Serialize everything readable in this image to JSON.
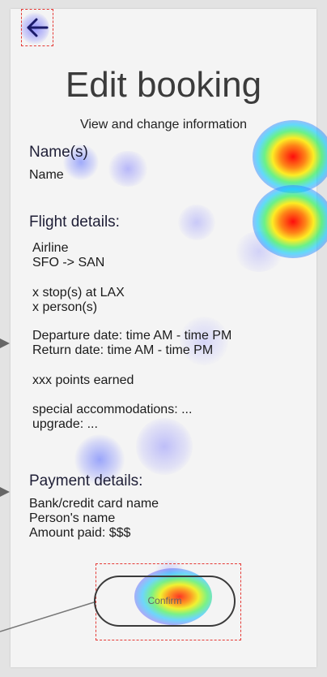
{
  "header": {
    "back_icon": "arrow-left-icon",
    "title": "Edit booking",
    "subtitle": "View and change information"
  },
  "name_section": {
    "heading": "Name(s)",
    "value": "Name"
  },
  "flight_section": {
    "heading": "Flight details:",
    "airline": "Airline",
    "route": "SFO -> SAN",
    "stops": "x stop(s) at LAX",
    "persons": "x person(s)",
    "departure": "Departure date: time AM - time PM",
    "return": "Return date: time AM - time PM",
    "points": "xxx points earned",
    "accommodations": "special accommodations: ...",
    "upgrade": "upgrade: ..."
  },
  "payment_section": {
    "heading": "Payment details:",
    "card": "Bank/credit card name",
    "person": "Person's name",
    "amount": "Amount paid: $$$"
  },
  "actions": {
    "confirm_label": "Confirm"
  },
  "colors": {
    "dashed_highlight": "#e53935",
    "card_background": "#f4f4f4",
    "page_background": "#e3e3e3"
  }
}
